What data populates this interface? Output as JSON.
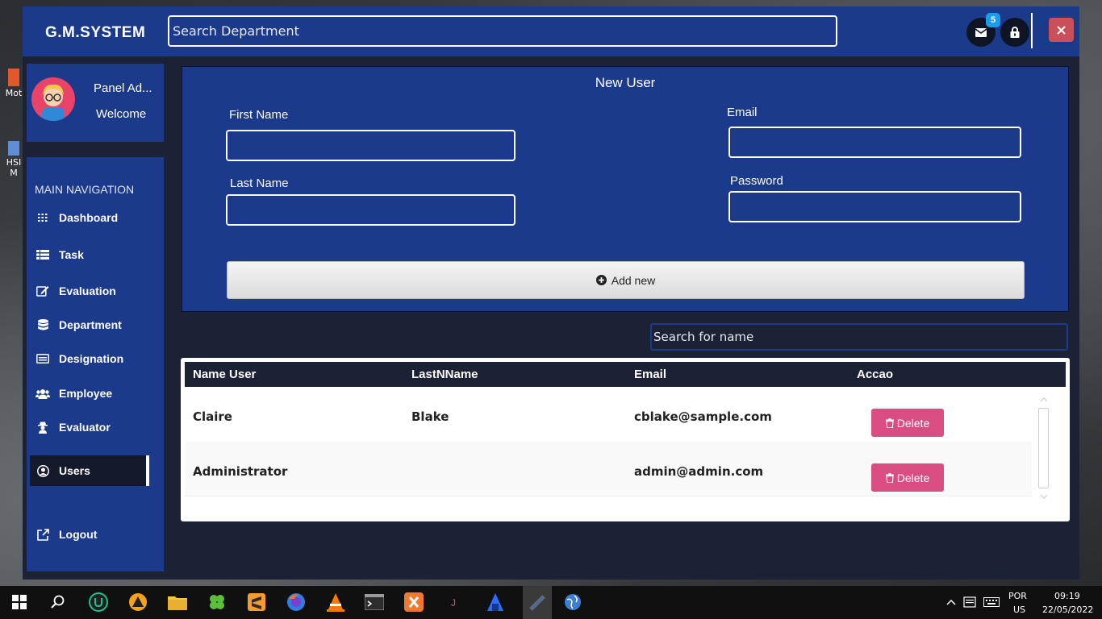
{
  "app": {
    "brand": "G.M.SYSTEM",
    "search_placeholder": "Search Department",
    "mail_badge": "5"
  },
  "profile": {
    "name": "Panel Ad...",
    "welcome": "Welcome"
  },
  "nav": {
    "title": "MAIN NAVIGATION",
    "items": [
      {
        "label": "Dashboard",
        "icon": "grid-icon"
      },
      {
        "label": "Task",
        "icon": "list-icon"
      },
      {
        "label": "Evaluation",
        "icon": "edit-icon"
      },
      {
        "label": "Department",
        "icon": "database-icon"
      },
      {
        "label": "Designation",
        "icon": "card-icon"
      },
      {
        "label": "Employee",
        "icon": "users-icon"
      },
      {
        "label": "Evaluator",
        "icon": "user-secret-icon"
      },
      {
        "label": "Users",
        "icon": "user-circle-icon",
        "active": true
      },
      {
        "label": "Logout",
        "icon": "external-link-icon"
      }
    ]
  },
  "form": {
    "title": "New User",
    "first_name_label": "First Name",
    "last_name_label": "Last Name",
    "email_label": "Email",
    "password_label": "Password",
    "first_name_value": "",
    "last_name_value": "",
    "email_value": "",
    "password_value": "",
    "add_button": "Add new"
  },
  "list": {
    "search_placeholder": "Search for name",
    "columns": [
      "Name User",
      "LastNName",
      "Email",
      "Accao"
    ],
    "rows": [
      {
        "name": "Claire",
        "lastname": "Blake",
        "email": "cblake@sample.com",
        "action": "Delete"
      },
      {
        "name": "Administrator",
        "lastname": "",
        "email": "admin@admin.com",
        "action": "Delete"
      }
    ]
  },
  "taskbar": {
    "lang": "POR",
    "layout": "US",
    "time": "09:19",
    "date": "22/05/2022"
  },
  "desktop": {
    "icons": [
      "Mot",
      "HSI M"
    ]
  },
  "colors": {
    "primary": "#1b3a8c",
    "dark": "#1b2236",
    "danger": "#d94d83",
    "close": "#c9505a"
  }
}
